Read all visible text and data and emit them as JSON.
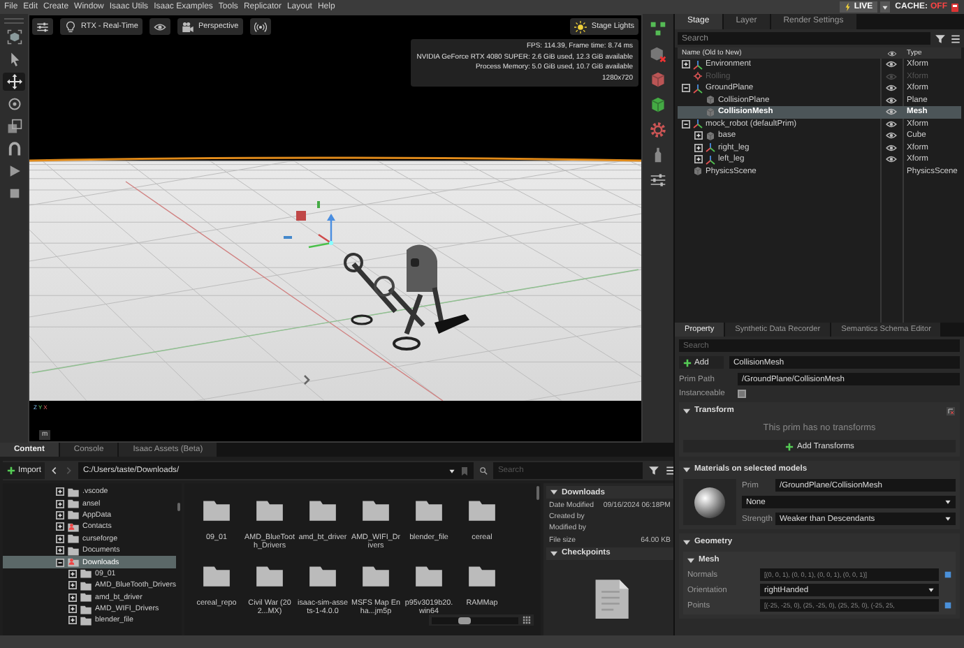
{
  "menu": [
    "File",
    "Edit",
    "Create",
    "Window",
    "Isaac Utils",
    "Isaac Examples",
    "Tools",
    "Replicator",
    "Layout",
    "Help"
  ],
  "live": {
    "label": "LIVE",
    "cache_label": "CACHE:",
    "cache_state": "OFF"
  },
  "left_tools": [
    {
      "kind": "select-box",
      "selected": false
    },
    {
      "kind": "pointer",
      "selected": false
    },
    {
      "kind": "move",
      "selected": true
    },
    {
      "kind": "rotate",
      "selected": false
    },
    {
      "kind": "scale",
      "selected": false
    },
    {
      "kind": "snap",
      "selected": false
    },
    {
      "kind": "play",
      "selected": false
    },
    {
      "kind": "stop",
      "selected": false
    }
  ],
  "right_tools": [
    {
      "kind": "cubes"
    },
    {
      "kind": "cube-x"
    },
    {
      "kind": "cube-red"
    },
    {
      "kind": "cube-green"
    },
    {
      "kind": "gear"
    },
    {
      "kind": "figure"
    },
    {
      "kind": "sliders"
    }
  ],
  "viewport": {
    "toolbar": [
      {
        "kind": "settings"
      },
      {
        "kind": "render",
        "label": "RTX - Real-Time"
      },
      {
        "kind": "eye"
      },
      {
        "kind": "camera",
        "label": "Perspective"
      },
      {
        "kind": "broadcast"
      }
    ],
    "lights": {
      "label": "Stage Lights"
    },
    "stats": [
      "FPS: 114.39, Frame time: 8.74 ms",
      "NVIDIA GeForce RTX 4080 SUPER: 2.6 GiB used, 12.3 GiB available",
      "Process Memory: 5.0 GiB used, 10.7 GiB available",
      "1280x720"
    ],
    "axes": [
      "Z",
      "Y",
      "X"
    ],
    "units": "m"
  },
  "stage": {
    "tabs": [
      {
        "label": "Stage",
        "selected": true
      },
      {
        "label": "Layer",
        "selected": false
      },
      {
        "label": "Render Settings",
        "selected": false
      }
    ],
    "search": {
      "placeholder": "Search"
    },
    "columns": [
      "Name (Old to New)",
      "Type"
    ],
    "rows": [
      {
        "name": "Environment",
        "type": "Xform",
        "kind": "xform",
        "visible": true,
        "expanded": false,
        "selected": false
      },
      {
        "name": "Rolling",
        "type": "Xform",
        "kind": "light",
        "visible": false,
        "selected": false
      },
      {
        "name": "GroundPlane",
        "type": "Xform",
        "kind": "xform",
        "visible": true,
        "expanded": true,
        "selected": false,
        "children": [
          {
            "name": "CollisionPlane",
            "type": "Plane",
            "kind": "mesh",
            "visible": true,
            "selected": false
          },
          {
            "name": "CollisionMesh",
            "type": "Mesh",
            "kind": "mesh",
            "visible": true,
            "selected": true
          }
        ]
      },
      {
        "name": "mock_robot (defaultPrim)",
        "type": "Xform",
        "kind": "xform",
        "visible": true,
        "expanded": true,
        "selected": false,
        "children": [
          {
            "name": "base",
            "type": "Cube",
            "kind": "mesh",
            "visible": true,
            "expanded": false,
            "selected": false
          },
          {
            "name": "right_leg",
            "type": "Xform",
            "kind": "xform",
            "visible": true,
            "expanded": false,
            "selected": false
          },
          {
            "name": "left_leg",
            "type": "Xform",
            "kind": "xform",
            "visible": true,
            "expanded": false,
            "selected": false
          }
        ]
      },
      {
        "name": "PhysicsScene",
        "type": "PhysicsScene",
        "kind": "mesh",
        "selected": false
      }
    ]
  },
  "property": {
    "tabs": [
      {
        "label": "Property",
        "selected": true
      },
      {
        "label": "Synthetic Data Recorder",
        "selected": false
      },
      {
        "label": "Semantics Schema Editor",
        "selected": false
      }
    ],
    "search": {
      "placeholder": "Search"
    },
    "add_button": "Add",
    "name": "CollisionMesh",
    "prim_path_label": "Prim Path",
    "prim_path": "/GroundPlane/CollisionMesh",
    "instanceable": {
      "label": "Instanceable",
      "checked": false
    },
    "transform": {
      "title": "Transform",
      "expanded": true,
      "message": "This prim has no transforms",
      "button": "Add Transforms"
    },
    "materials": {
      "title": "Materials on selected models",
      "expanded": true,
      "prim_label": "Prim",
      "prim": "/GroundPlane/CollisionMesh",
      "material": "None",
      "strength_label": "Strength",
      "strength": "Weaker than Descendants"
    },
    "geometry": {
      "title": "Geometry",
      "expanded": true,
      "mesh": {
        "title": "Mesh",
        "expanded": true,
        "attributes": [
          {
            "kind": "text",
            "label": "Normals",
            "value": "[(0, 0, 1), (0, 0, 1), (0, 0, 1), (0, 0, 1)]"
          },
          {
            "kind": "dropdown",
            "label": "Orientation",
            "value": "rightHanded"
          },
          {
            "kind": "text",
            "label": "Points",
            "value": "[(-25, -25, 0), (25, -25, 0), (25, 25, 0), (-25, 25,"
          }
        ]
      }
    }
  },
  "content": {
    "tabs": [
      {
        "label": "Content",
        "selected": true
      },
      {
        "label": "Console",
        "selected": false
      },
      {
        "label": "Isaac Assets (Beta)",
        "selected": false
      }
    ],
    "import": "Import",
    "path": "C:/Users/taste/Downloads/",
    "search": {
      "placeholder": "Search"
    },
    "tree": [
      {
        "name": ".vscode",
        "kind": "folder",
        "expanded": false,
        "selected": false
      },
      {
        "name": "ansel",
        "kind": "folder",
        "expanded": false,
        "selected": false
      },
      {
        "name": "AppData",
        "kind": "folder",
        "expanded": false,
        "selected": false
      },
      {
        "name": "Contacts",
        "kind": "special",
        "expanded": false,
        "selected": false
      },
      {
        "name": "curseforge",
        "kind": "folder",
        "expanded": false,
        "selected": false
      },
      {
        "name": "Documents",
        "kind": "folder",
        "expanded": false,
        "selected": false
      },
      {
        "name": "Downloads",
        "kind": "special",
        "expanded": true,
        "selected": true,
        "children": [
          {
            "name": "09_01",
            "kind": "folder",
            "expanded": false,
            "selected": false
          },
          {
            "name": "AMD_BlueTooth_Drivers",
            "kind": "folder",
            "expanded": false,
            "selected": false
          },
          {
            "name": "amd_bt_driver",
            "kind": "folder",
            "expanded": false,
            "selected": false
          },
          {
            "name": "AMD_WIFI_Drivers",
            "kind": "folder",
            "expanded": false,
            "selected": false
          },
          {
            "name": "blender_file",
            "kind": "folder",
            "expanded": false,
            "selected": false
          }
        ]
      }
    ],
    "items": [
      "09_01",
      "AMD_BlueTooth_Drivers",
      "amd_bt_driver",
      "AMD_WIFI_Drivers",
      "blender_file",
      "cereal",
      "cereal_repo",
      "Civil War (202...MX)",
      "isaac-sim-assets-1-4.0.0",
      "MSFS Map Enha...jm5p",
      "p95v3019b20.win64",
      "RAMMap"
    ],
    "zoom_slider": {
      "level": 0.35
    },
    "details": {
      "title": "Downloads",
      "expanded": true,
      "rows": [
        {
          "label": "Date Modified",
          "value": "09/16/2024 06:18PM"
        },
        {
          "label": "Created by"
        },
        {
          "label": "Modified by"
        },
        {
          "label": "File size",
          "value": "64.00 KB"
        }
      ],
      "checkpoints": {
        "title": "Checkpoints",
        "expanded": true
      }
    }
  }
}
